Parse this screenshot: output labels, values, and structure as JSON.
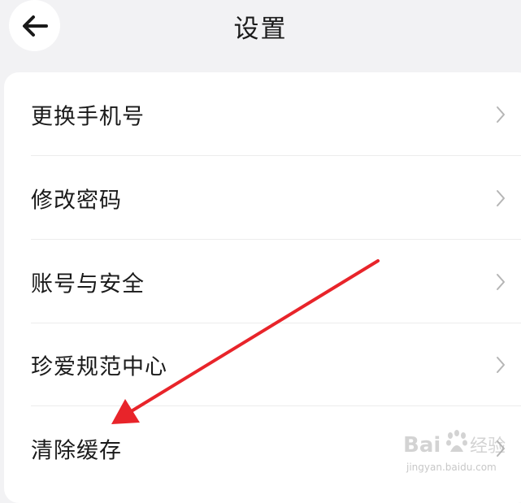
{
  "header": {
    "title": "设置",
    "back_icon": "arrow-left-icon"
  },
  "settings": {
    "items": [
      {
        "label": "更换手机号",
        "icon": "chevron-right-icon"
      },
      {
        "label": "修改密码",
        "icon": "chevron-right-icon"
      },
      {
        "label": "账号与安全",
        "icon": "chevron-right-icon"
      },
      {
        "label": "珍爱规范中心",
        "icon": "chevron-right-icon"
      },
      {
        "label": "清除缓存",
        "icon": "chevron-right-icon"
      }
    ]
  },
  "annotation": {
    "type": "red-arrow",
    "points_to": "清除缓存",
    "color": "#e8242a"
  },
  "watermark": {
    "brand": "Bai 经验",
    "url": "jingyan.baidu.com"
  },
  "colors": {
    "background": "#f2f2f4",
    "card": "#ffffff",
    "text": "#1a1a1a",
    "chevron": "#b5b5b5",
    "arrow": "#e8242a"
  }
}
